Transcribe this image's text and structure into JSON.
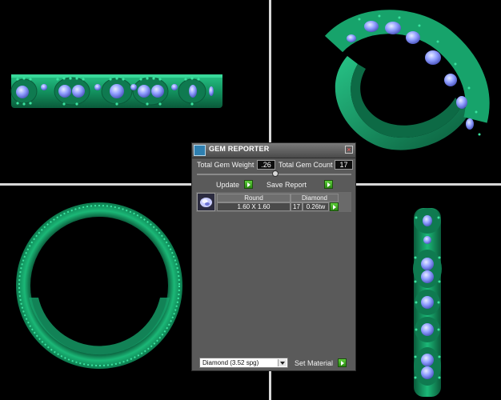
{
  "panel": {
    "title": "GEM REPORTER",
    "total_weight_label": "Total Gem Weight",
    "total_weight_value": ".26",
    "total_count_label": "Total Gem Count",
    "total_count_value": "17",
    "update_label": "Update",
    "save_report_label": "Save Report",
    "table": {
      "col_shape": "Round",
      "col_material": "Diamond",
      "size": "1.60 X 1.60",
      "count": "17",
      "weight": "0.26tw"
    },
    "material_select_value": "Diamond     (3.52 spg)",
    "set_material_label": "Set Material"
  },
  "colors": {
    "metal": "#1aa36d",
    "metal_dark": "#0b5c3c",
    "gem": "#8f9dff",
    "background": "#000000",
    "panel": "#5a5a5a",
    "go_button": "#3cb81e"
  },
  "icons": {
    "app": "gem-reporter-icon",
    "close": "close-icon",
    "go": "green-arrow-icon",
    "dropdown": "chevron-down-icon"
  }
}
